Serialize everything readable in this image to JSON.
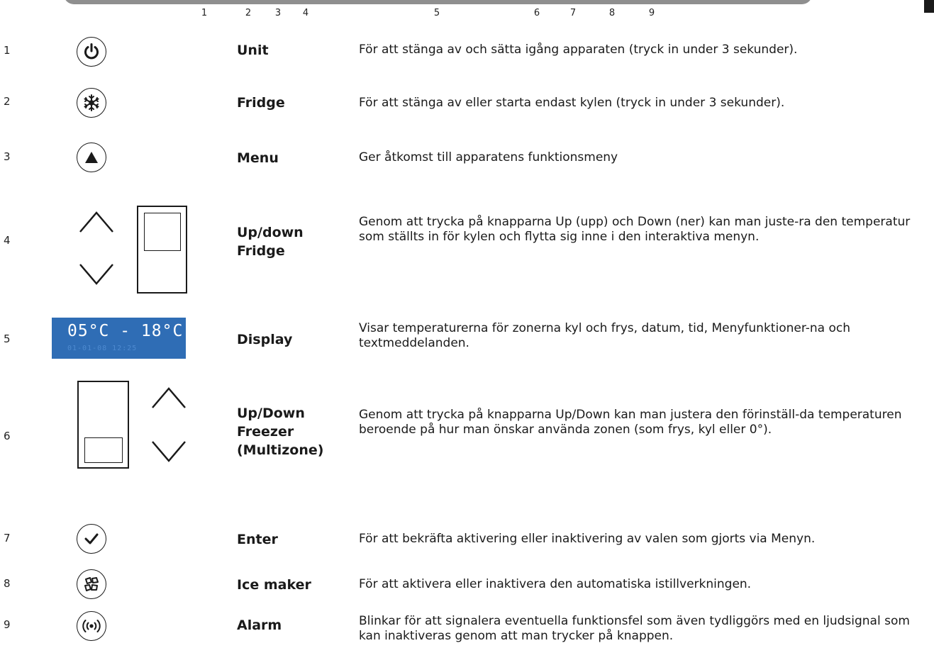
{
  "header": {
    "numbers": [
      "1",
      "2",
      "3",
      "4",
      "5",
      "6",
      "7",
      "8",
      "9"
    ]
  },
  "display": {
    "main_text": "05°C - 18°C",
    "sub_text": "01-01-08 12:25"
  },
  "rows": [
    {
      "number": "1",
      "icon": "power-icon",
      "label": "Unit",
      "description": "För att stänga av och sätta igång apparaten (tryck in under 3 sekunder)."
    },
    {
      "number": "2",
      "icon": "snowflake-icon",
      "label": "Fridge",
      "description": "För att stänga av eller starta endast kylen (tryck in under 3 sekunder)."
    },
    {
      "number": "3",
      "icon": "triangle-up-icon",
      "label": "Menu",
      "description": "Ger åtkomst till apparatens funktionsmeny"
    },
    {
      "number": "4",
      "icon": "up-down-slider-icon",
      "label": "Up/down\nFridge",
      "description": "Genom att trycka på knapparna Up (upp) och Down (ner) kan man juste-ra den temperatur som ställts in för kylen och flytta sig inne i den interaktiva menyn."
    },
    {
      "number": "5",
      "icon": "display-icon",
      "label": "Display",
      "description": "Visar temperaturerna för zonerna kyl och frys, datum, tid, Menyfunktioner-na och textmeddelanden."
    },
    {
      "number": "6",
      "icon": "up-down-slider-icon",
      "label": "Up/Down\nFreezer\n(Multizone)",
      "description": "Genom att trycka på knapparna Up/Down kan man justera den förinställ-da temperaturen beroende på hur man önskar använda zonen (som frys, kyl eller 0°)."
    },
    {
      "number": "7",
      "icon": "checkmark-icon",
      "label": "Enter",
      "description": "För att bekräfta aktivering eller inaktivering av valen som gjorts via Menyn."
    },
    {
      "number": "8",
      "icon": "ice-cube-icon",
      "label": "Ice maker",
      "description": "För att aktivera eller inaktivera den automatiska istillverkningen."
    },
    {
      "number": "9",
      "icon": "alarm-icon",
      "label": "Alarm",
      "description": "Blinkar för att signalera eventuella funktionsfel som även tydliggörs med en ljudsignal som kan inaktiveras genom att man trycker på knappen."
    }
  ]
}
